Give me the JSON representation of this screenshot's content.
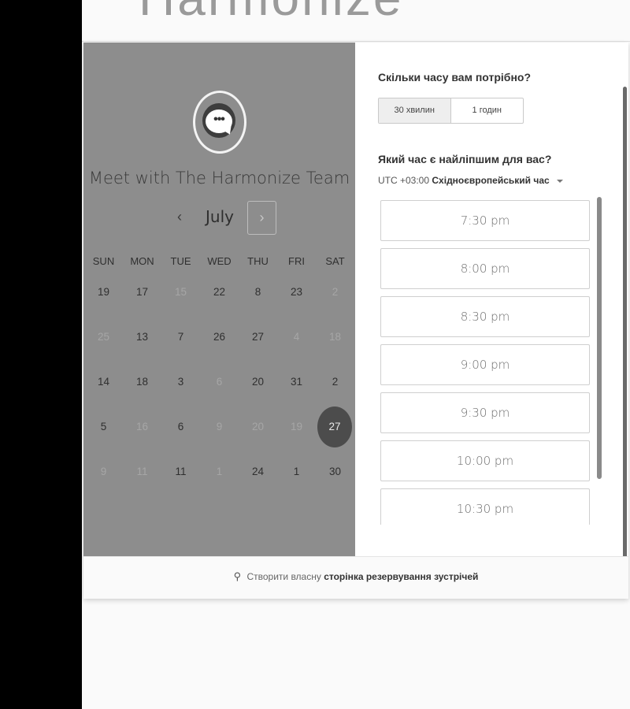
{
  "header": {
    "logo_text": "Harmonize"
  },
  "calendar": {
    "title": "Meet with The Harmonize Team",
    "month": "July",
    "prev_icon": "‹",
    "next_icon": "›",
    "weekdays": [
      "SUN",
      "MON",
      "TUE",
      "WED",
      "THU",
      "FRI",
      "SAT"
    ],
    "weeks": [
      [
        {
          "d": "19",
          "m": false
        },
        {
          "d": "17",
          "m": false
        },
        {
          "d": "15",
          "m": true
        },
        {
          "d": "22",
          "m": false
        },
        {
          "d": "8",
          "m": false
        },
        {
          "d": "23",
          "m": false
        },
        {
          "d": "2",
          "m": true
        }
      ],
      [
        {
          "d": "25",
          "m": true
        },
        {
          "d": "13",
          "m": false
        },
        {
          "d": "7",
          "m": false
        },
        {
          "d": "26",
          "m": false
        },
        {
          "d": "27",
          "m": false
        },
        {
          "d": "4",
          "m": true
        },
        {
          "d": "18",
          "m": true
        }
      ],
      [
        {
          "d": "14",
          "m": false
        },
        {
          "d": "18",
          "m": false
        },
        {
          "d": "3",
          "m": false
        },
        {
          "d": "6",
          "m": true
        },
        {
          "d": "20",
          "m": false
        },
        {
          "d": "31",
          "m": false
        },
        {
          "d": "2",
          "m": false
        }
      ],
      [
        {
          "d": "5",
          "m": false
        },
        {
          "d": "16",
          "m": true
        },
        {
          "d": "6",
          "m": false
        },
        {
          "d": "9",
          "m": true
        },
        {
          "d": "20",
          "m": true
        },
        {
          "d": "19",
          "m": true
        },
        {
          "d": "27",
          "m": false,
          "selected": true
        }
      ],
      [
        {
          "d": "9",
          "m": true
        },
        {
          "d": "11",
          "m": true
        },
        {
          "d": "11",
          "m": false
        },
        {
          "d": "1",
          "m": true
        },
        {
          "d": "24",
          "m": false
        },
        {
          "d": "1",
          "m": false
        },
        {
          "d": "30",
          "m": false
        }
      ]
    ]
  },
  "booking": {
    "duration_question": "Скільки часу вам потрібно?",
    "durations": [
      "30 хвилин",
      "1 годин"
    ],
    "time_question": "Який час є найліпшим для вас?",
    "timezone_offset": "UTC +03:00",
    "timezone_name": "Східноєвропейський час",
    "slots": [
      "7:30 pm",
      "8:00 pm",
      "8:30 pm",
      "9:00 pm",
      "9:30 pm",
      "10:00 pm",
      "10:30 pm"
    ]
  },
  "footer": {
    "icon": "sprocket-icon",
    "prefix": "Створити власну",
    "link": "сторінка резервування зустрічей"
  }
}
